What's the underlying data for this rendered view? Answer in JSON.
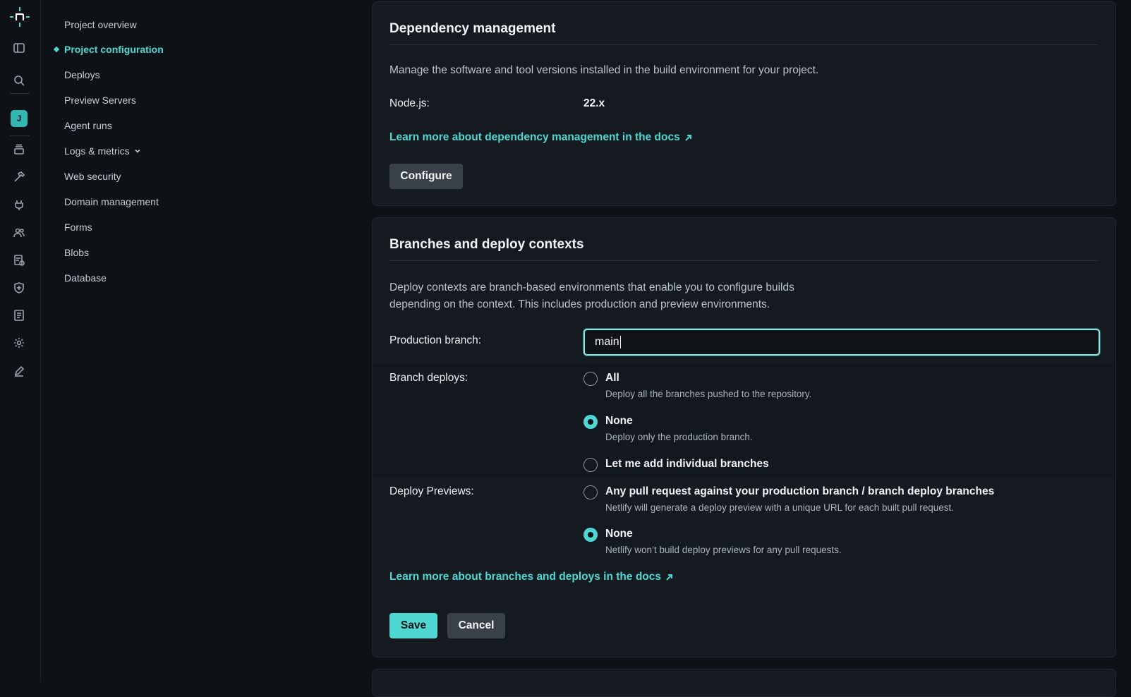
{
  "rail": {
    "avatar_letter": "J",
    "icons": [
      "netlify-logo-icon",
      "sidebar-toggle-icon",
      "search-icon",
      "layers-icon",
      "hammer-icon",
      "plug-icon",
      "team-icon",
      "billing-icon",
      "shield-icon",
      "docs-icon",
      "gear-icon",
      "edit-icon"
    ]
  },
  "sidebar": {
    "items": [
      {
        "label": "Project overview"
      },
      {
        "label": "Project configuration",
        "active": true
      },
      {
        "label": "Deploys"
      },
      {
        "label": "Preview Servers"
      },
      {
        "label": "Agent runs"
      },
      {
        "label": "Logs & metrics",
        "has_dropdown": true
      },
      {
        "label": "Web security"
      },
      {
        "label": "Domain management"
      },
      {
        "label": "Forms"
      },
      {
        "label": "Blobs"
      },
      {
        "label": "Database"
      }
    ]
  },
  "dependency": {
    "title": "Dependency management",
    "description": "Manage the software and tool versions installed in the build environment for your project.",
    "node_label": "Node.js:",
    "node_value": "22.x",
    "docs_link": "Learn more about dependency management in the docs",
    "configure_label": "Configure"
  },
  "branches": {
    "title": "Branches and deploy contexts",
    "description_line1": "Deploy contexts are branch-based environments that enable you to configure builds",
    "description_line2": "depending on the context. This includes production and preview environments.",
    "production_label": "Production branch:",
    "production_value": "main",
    "branch_deploys_label": "Branch deploys:",
    "branch_options": [
      {
        "title": "All",
        "desc": "Deploy all the branches pushed to the repository.",
        "selected": false
      },
      {
        "title": "None",
        "desc": "Deploy only the production branch.",
        "selected": true
      },
      {
        "title": "Let me add individual branches",
        "desc": "",
        "selected": false
      }
    ],
    "previews_label": "Deploy Previews:",
    "preview_options": [
      {
        "title": "Any pull request against your production branch / branch deploy branches",
        "desc": "Netlify will generate a deploy preview with a unique URL for each built pull request.",
        "selected": false
      },
      {
        "title": "None",
        "desc": "Netlify won’t build deploy previews for any pull requests.",
        "selected": true
      }
    ],
    "docs_link": "Learn more about branches and deploys in the docs",
    "save_label": "Save",
    "cancel_label": "Cancel"
  },
  "colors": {
    "accent": "#4fd8d2",
    "background": "#0e1217",
    "card": "#151a21"
  }
}
